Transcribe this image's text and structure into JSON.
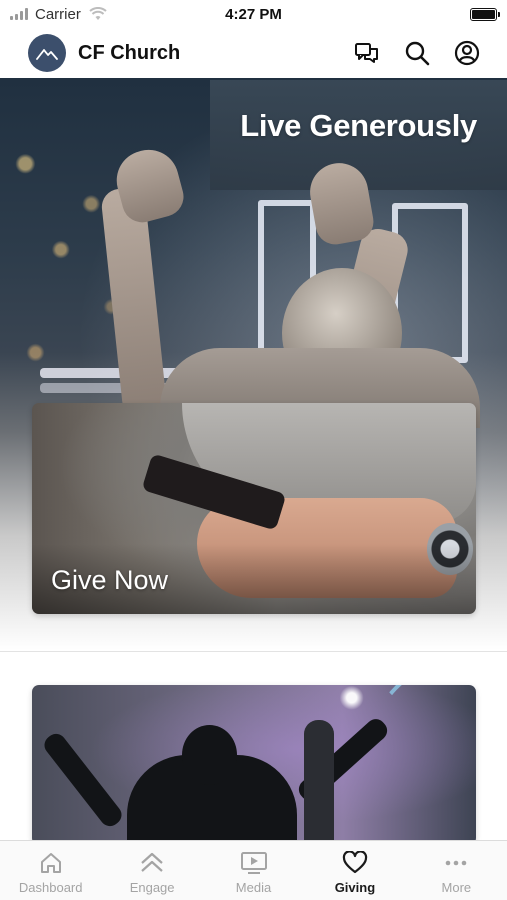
{
  "status_bar": {
    "carrier": "Carrier",
    "time": "4:27 PM",
    "battery_level": 1.0
  },
  "header": {
    "title": "CF Church",
    "logo_icon": "mountain-icon",
    "actions": [
      {
        "icon": "chat-icon"
      },
      {
        "icon": "search-icon"
      },
      {
        "icon": "profile-icon"
      }
    ]
  },
  "hero": {
    "title": "Live Generously"
  },
  "cards": [
    {
      "label": "Give Now"
    },
    {
      "label": ""
    }
  ],
  "tab_bar": {
    "active": "Giving",
    "tabs": [
      {
        "label": "Dashboard",
        "icon": "home-icon"
      },
      {
        "label": "Engage",
        "icon": "chevrons-up-icon"
      },
      {
        "label": "Media",
        "icon": "play-screen-icon"
      },
      {
        "label": "Giving",
        "icon": "heart-icon"
      },
      {
        "label": "More",
        "icon": "more-dots-icon"
      }
    ]
  },
  "colors": {
    "logo_bg": "#3c4f6c",
    "tab_active": "#1a1a1a",
    "tab_inactive": "#a4a4a4"
  }
}
